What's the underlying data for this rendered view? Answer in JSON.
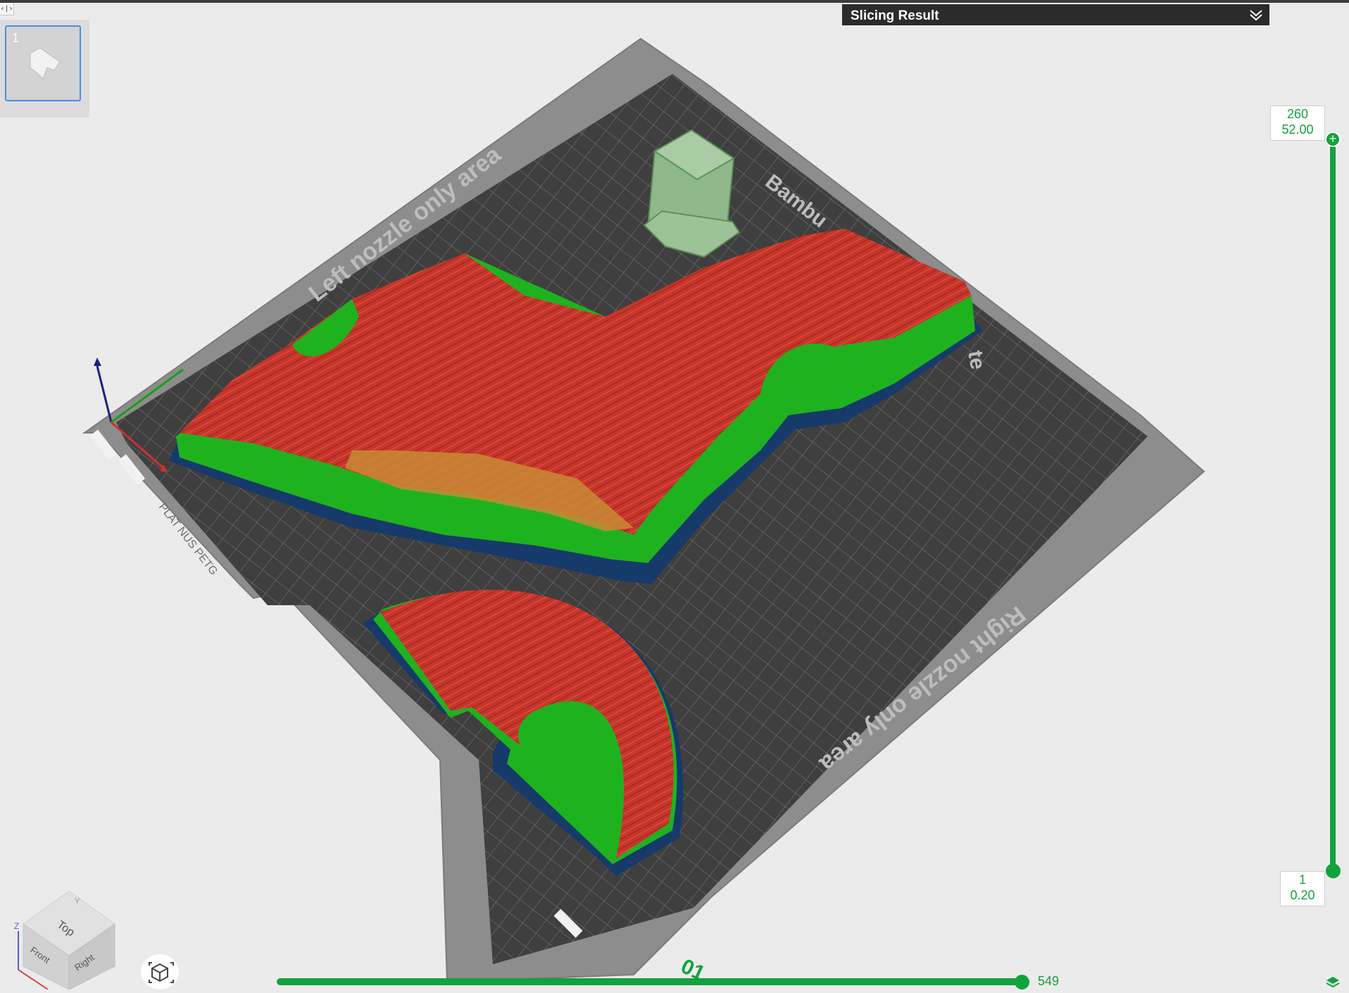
{
  "toolbar": {
    "collapse_glyph": "‹|›"
  },
  "plates": [
    {
      "number": "1",
      "selected": true
    }
  ],
  "slicing_result": {
    "title": "Slicing Result",
    "icon": "double-chevron-down-icon"
  },
  "bed": {
    "left_label": "Left nozzle only area",
    "right_label": "Right nozzle only area",
    "brand_fragment": "Bambu",
    "plate_type_fragment": "te",
    "plate_tag": "PLAT NUS PETG",
    "corner_label": "01"
  },
  "layer_slider": {
    "top_layer": "260",
    "top_height": "52.00",
    "bottom_layer": "1",
    "bottom_height": "0.20"
  },
  "move_slider": {
    "value": "549"
  },
  "view_cube": {
    "top": "Top",
    "front": "Front",
    "right": "Right",
    "axis_z": "Z",
    "axis_y": "Y"
  },
  "colors": {
    "accent_green": "#12a23e",
    "model_top_red": "#c8352a",
    "model_wall_green": "#1fb21f",
    "bed_dark": "#3f3f3f",
    "bed_frame": "#8d8d8d",
    "header_bg": "#2b2b2b"
  }
}
